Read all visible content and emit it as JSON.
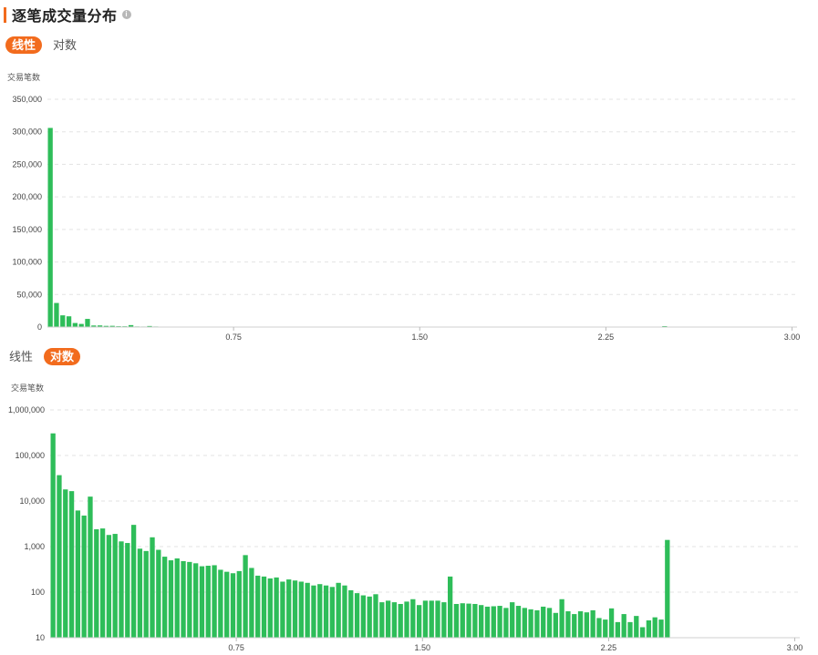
{
  "header": {
    "title": "逐笔成交量分布",
    "info_icon": "info-icon"
  },
  "toggles": {
    "linear_label": "线性",
    "log_label": "对数"
  },
  "colors": {
    "accent": "#f26b1d",
    "bar": "#2ebd59",
    "grid": "#e3e3e3"
  },
  "chart_data": [
    {
      "type": "bar",
      "scale": "linear",
      "ylabel": "交易笔数",
      "ylim": [
        0,
        350000
      ],
      "yticks": [
        0,
        50000,
        100000,
        150000,
        200000,
        250000,
        300000,
        350000
      ],
      "ytick_labels": [
        "0",
        "50,000",
        "100,000",
        "150,000",
        "200,000",
        "250,000",
        "300,000",
        "350,000"
      ],
      "xlim": [
        0,
        3.02
      ],
      "xticks": [
        0.75,
        1.5,
        2.25,
        3.0
      ],
      "xtick_labels": [
        "0.75",
        "1.50",
        "2.25",
        "3.00"
      ],
      "bin_width": 0.025,
      "grid": "horizontal dashed",
      "values": [
        306000,
        37000,
        18000,
        16500,
        6200,
        4800,
        12500,
        2400,
        2500,
        1800,
        1900,
        1300,
        1200,
        3000,
        900,
        800,
        1600,
        850,
        600,
        500,
        550,
        480,
        460,
        430,
        370,
        380,
        390,
        310,
        280,
        260,
        290,
        650,
        340,
        230,
        220,
        200,
        210,
        170,
        190,
        180,
        170,
        160,
        140,
        150,
        140,
        130,
        160,
        140,
        110,
        95,
        85,
        80,
        90,
        60,
        65,
        60,
        55,
        62,
        70,
        52,
        65,
        65,
        65,
        60,
        220,
        55,
        57,
        56,
        55,
        52,
        48,
        49,
        50,
        45,
        60,
        50,
        45,
        42,
        40,
        48,
        45,
        35,
        70,
        38,
        33,
        38,
        36,
        40,
        27,
        25,
        44,
        22,
        33,
        22,
        30,
        17,
        24,
        28,
        25,
        1400
      ]
    },
    {
      "type": "bar",
      "scale": "log",
      "ylabel": "交易笔数",
      "ylim": [
        10,
        1000000
      ],
      "yticks": [
        10,
        100,
        1000,
        10000,
        100000,
        1000000
      ],
      "ytick_labels": [
        "10",
        "100",
        "1,000",
        "10,000",
        "100,000",
        "1,000,000"
      ],
      "xlim": [
        0,
        3.02
      ],
      "xticks": [
        0.75,
        1.5,
        2.25,
        3.0
      ],
      "xtick_labels": [
        "0.75",
        "1.50",
        "2.25",
        "3.00"
      ],
      "bin_width": 0.025,
      "grid": "horizontal dashed",
      "values": [
        306000,
        37000,
        18000,
        16500,
        6200,
        4800,
        12500,
        2400,
        2500,
        1800,
        1900,
        1300,
        1200,
        3000,
        900,
        800,
        1600,
        850,
        600,
        500,
        550,
        480,
        460,
        430,
        370,
        380,
        390,
        310,
        280,
        260,
        290,
        650,
        340,
        230,
        220,
        200,
        210,
        170,
        190,
        180,
        170,
        160,
        140,
        150,
        140,
        130,
        160,
        140,
        110,
        95,
        85,
        80,
        90,
        60,
        65,
        60,
        55,
        62,
        70,
        52,
        65,
        65,
        65,
        60,
        220,
        55,
        57,
        56,
        55,
        52,
        48,
        49,
        50,
        45,
        60,
        50,
        45,
        42,
        40,
        48,
        45,
        35,
        70,
        38,
        33,
        38,
        36,
        40,
        27,
        25,
        44,
        22,
        33,
        22,
        30,
        17,
        24,
        28,
        25,
        1400
      ]
    }
  ]
}
